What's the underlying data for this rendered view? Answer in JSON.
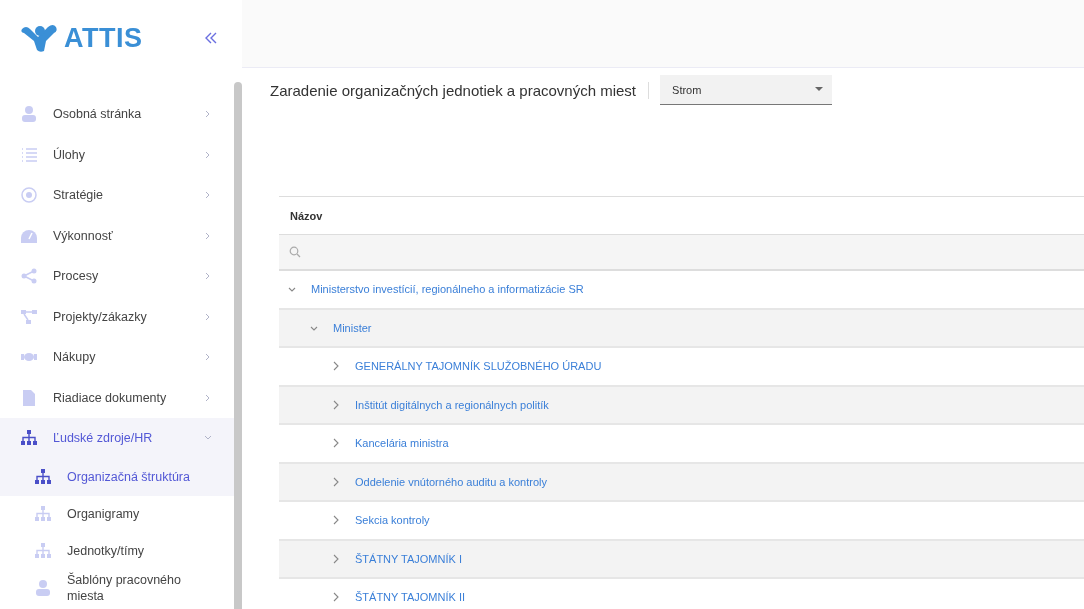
{
  "logo": {
    "text": "ATTIS"
  },
  "sidebar": {
    "items": [
      {
        "label": "Osobná stránka",
        "expanded": false
      },
      {
        "label": "Úlohy",
        "expanded": false
      },
      {
        "label": "Stratégie",
        "expanded": false
      },
      {
        "label": "Výkonnosť",
        "expanded": false
      },
      {
        "label": "Procesy",
        "expanded": false
      },
      {
        "label": "Projekty/zákazky",
        "expanded": false
      },
      {
        "label": "Nákupy",
        "expanded": false
      },
      {
        "label": "Riadiace dokumenty",
        "expanded": false
      },
      {
        "label": "Ľudské zdroje/HR",
        "expanded": true,
        "children": [
          {
            "label": "Organizačná štruktúra",
            "selected": true
          },
          {
            "label": "Organigramy",
            "selected": false
          },
          {
            "label": "Jednotky/tímy",
            "selected": false
          },
          {
            "label": "Šablóny pracovného miesta",
            "selected": false
          }
        ]
      }
    ]
  },
  "page": {
    "title": "Zaradenie organizačných jednotiek a pracovných miest",
    "view_select": {
      "value": "Strom"
    }
  },
  "tree_table": {
    "columns": [
      "Názov"
    ],
    "rows": [
      {
        "label": "Ministerstvo investícií, regionálneho a informatizácie SR",
        "expanded": true,
        "children": [
          {
            "label": "Minister",
            "expanded": true,
            "children": [
              {
                "label": "GENERÁLNY TAJOMNÍK SLUŽOBNÉHO ÚRADU",
                "expanded": false
              },
              {
                "label": "Inštitút digitálnych a regionálnych politík",
                "expanded": false
              },
              {
                "label": "Kancelária ministra",
                "expanded": false
              },
              {
                "label": "Oddelenie vnútorného auditu a kontroly",
                "expanded": false
              },
              {
                "label": "Sekcia kontroly",
                "expanded": false
              },
              {
                "label": "ŠTÁTNY TAJOMNÍK I",
                "expanded": false
              },
              {
                "label": "ŠTÁTNY TAJOMNÍK II",
                "expanded": false
              }
            ]
          }
        ]
      }
    ]
  }
}
